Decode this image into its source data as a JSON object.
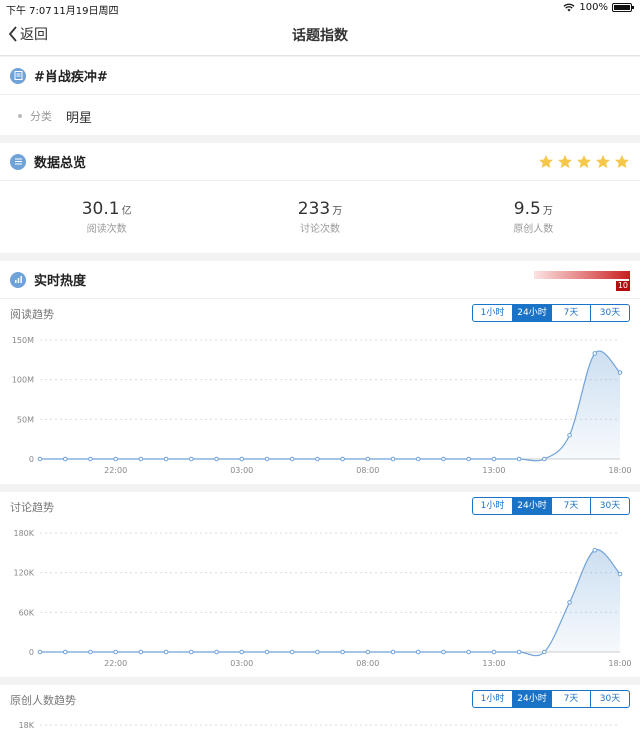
{
  "status_bar": {
    "time": "下午 7:07",
    "date": "11月19日周四",
    "battery": "100%"
  },
  "nav": {
    "back_label": "返回",
    "title": "话题指数"
  },
  "topic": {
    "name": "#肖战疾冲#",
    "category_label": "分类",
    "category_value": "明星"
  },
  "overview": {
    "title": "数据总览",
    "rating_stars": 5,
    "star_color": "#f5c84c",
    "stats": [
      {
        "value": "30.1",
        "unit": "亿",
        "label": "阅读次数"
      },
      {
        "value": "233",
        "unit": "万",
        "label": "讨论次数"
      },
      {
        "value": "9.5",
        "unit": "万",
        "label": "原创人数"
      }
    ]
  },
  "realtime": {
    "title": "实时热度",
    "heat_value": "10"
  },
  "range_tabs": [
    "1小时",
    "24小时",
    "7天",
    "30天"
  ],
  "active_tab": "24小时",
  "colors": {
    "accent": "#1a73c7",
    "line": "#6fa2d8",
    "area": "#e3eefa"
  },
  "chart_data": [
    {
      "type": "area",
      "title": "阅读趋势",
      "x_ticks": [
        "22:00",
        "03:00",
        "08:00",
        "13:00",
        "18:00"
      ],
      "y_ticks": [
        "0",
        "50M",
        "100M",
        "150M"
      ],
      "ylim": [
        0,
        150000000
      ],
      "values": [
        0,
        0,
        0,
        0,
        0,
        0,
        0,
        0,
        0,
        0,
        0,
        0,
        0,
        0,
        0,
        0,
        0,
        0,
        0,
        0,
        0,
        30000000,
        133000000,
        109000000
      ]
    },
    {
      "type": "area",
      "title": "讨论趋势",
      "x_ticks": [
        "22:00",
        "03:00",
        "08:00",
        "13:00",
        "18:00"
      ],
      "y_ticks": [
        "0",
        "60K",
        "120K",
        "180K"
      ],
      "ylim": [
        0,
        180000
      ],
      "values": [
        0,
        0,
        0,
        0,
        0,
        0,
        0,
        0,
        0,
        0,
        0,
        0,
        0,
        0,
        0,
        0,
        0,
        0,
        0,
        0,
        0,
        75000,
        154000,
        118000
      ]
    },
    {
      "type": "area",
      "title": "原创人数趋势",
      "x_ticks": [],
      "y_ticks": [
        "18K"
      ],
      "ylim": [
        0,
        18000
      ],
      "values": []
    }
  ]
}
